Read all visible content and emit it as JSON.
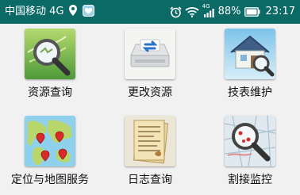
{
  "status_bar": {
    "carrier": "中国移动",
    "network": "4G",
    "signal_network": "4G",
    "battery": "88%",
    "time": "23:17",
    "icons": [
      "location-icon",
      "notification-app-icon",
      "alarm-icon",
      "wifi-icon",
      "cell-signal-icon",
      "battery-icon"
    ]
  },
  "menu": {
    "items": [
      {
        "label": "资源查询",
        "icon": "resource-search-icon"
      },
      {
        "label": "更改资源",
        "icon": "change-resource-icon"
      },
      {
        "label": "技表维护",
        "icon": "maintenance-house-icon"
      },
      {
        "label": "定位与地图服务",
        "icon": "map-location-icon"
      },
      {
        "label": "日志查询",
        "icon": "log-document-icon"
      },
      {
        "label": "割接监控",
        "icon": "cutover-monitor-icon"
      }
    ]
  },
  "colors": {
    "status_bar_bg": "#0c6a66",
    "page_bg": "#f1f1f1"
  }
}
